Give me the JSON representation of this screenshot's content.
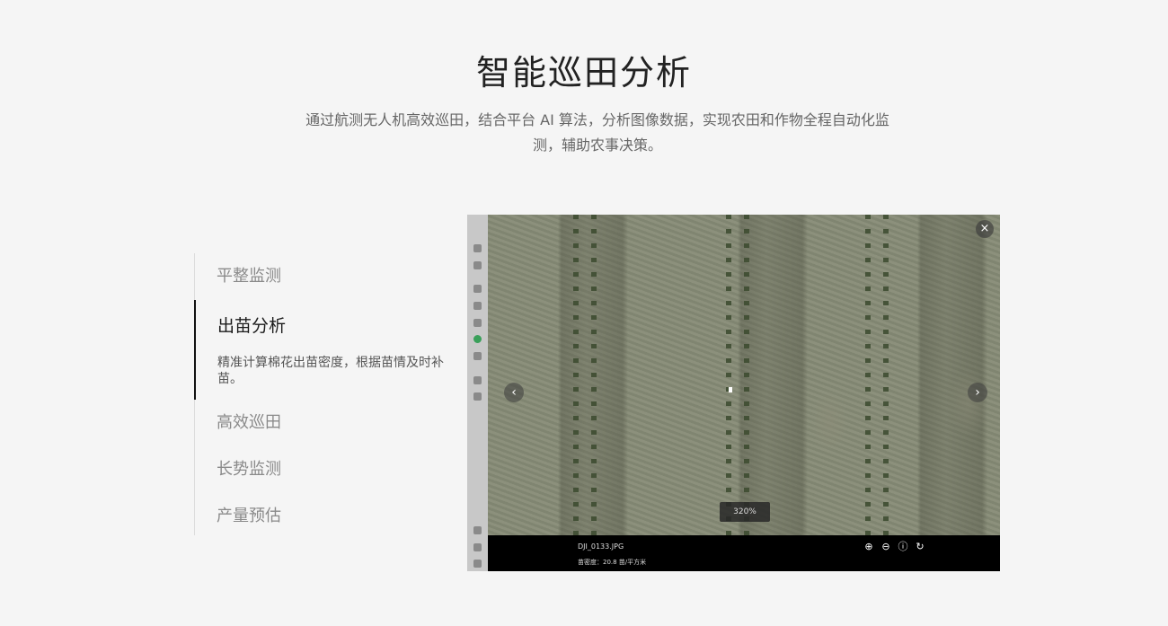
{
  "section": {
    "title": "智能巡田分析",
    "description": "通过航测无人机高效巡田，结合平台 AI 算法，分析图像数据，实现农田和作物全程自动化监测，辅助农事决策。"
  },
  "menu": {
    "items": [
      {
        "label": "平整监测"
      },
      {
        "label": "出苗分析",
        "detail": "精准计算棉花出苗密度，根据苗情及时补苗。",
        "active": true
      },
      {
        "label": "高效巡田"
      },
      {
        "label": "长势监测"
      },
      {
        "label": "产量预估"
      }
    ]
  },
  "viewer": {
    "close_icon": "×",
    "prev_icon": "‹",
    "next_icon": "›",
    "zoom_level": "320%",
    "filename": "DJI_0133.JPG",
    "density_text": "苗密度：20.8 苗/平方米",
    "tools": {
      "zoom_in_icon": "⊕",
      "zoom_out_icon": "⊖",
      "info_icon": "ⓘ",
      "rotate_icon": "↻"
    }
  },
  "colors": {
    "background": "#f5f5f5",
    "active_marker": "#111111",
    "rail": "#c8c8c8"
  }
}
